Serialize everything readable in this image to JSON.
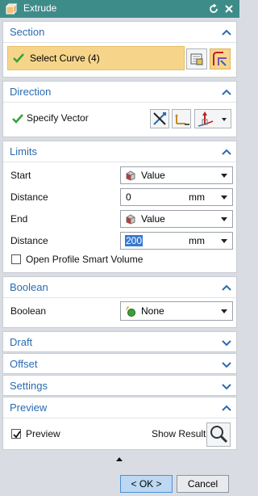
{
  "window": {
    "title": "Extrude"
  },
  "colors": {
    "titlebar": "#3e8c8a",
    "section_title": "#2a6bb0",
    "highlight": "#f6d58b",
    "check_green": "#3aa23a"
  },
  "sections": {
    "section": {
      "title": "Section",
      "select_curve_label": "Select Curve (4)",
      "expanded": true
    },
    "direction": {
      "title": "Direction",
      "specify_vector_label": "Specify Vector",
      "expanded": true
    },
    "limits": {
      "title": "Limits",
      "start_label": "Start",
      "start_value": "Value",
      "start_distance_label": "Distance",
      "start_distance_value": "0",
      "start_distance_unit": "mm",
      "end_label": "End",
      "end_value": "Value",
      "end_distance_label": "Distance",
      "end_distance_value": "200",
      "end_distance_unit": "mm",
      "open_profile_label": "Open Profile Smart Volume",
      "open_profile_checked": false,
      "expanded": true
    },
    "boolean": {
      "title": "Boolean",
      "boolean_label": "Boolean",
      "boolean_value": "None",
      "expanded": true
    },
    "draft": {
      "title": "Draft",
      "expanded": false
    },
    "offset": {
      "title": "Offset",
      "expanded": false
    },
    "settings": {
      "title": "Settings",
      "expanded": false
    },
    "preview": {
      "title": "Preview",
      "preview_label": "Preview",
      "preview_checked": true,
      "show_result_label": "Show Result",
      "expanded": true
    }
  },
  "footer": {
    "ok_label": "< OK >",
    "cancel_label": "Cancel"
  },
  "icons": {
    "app": "extrude-app-icon",
    "reset": "reset-icon",
    "close": "close-icon",
    "collapse": "chevron-up-icon",
    "expand": "chevron-down-icon"
  }
}
